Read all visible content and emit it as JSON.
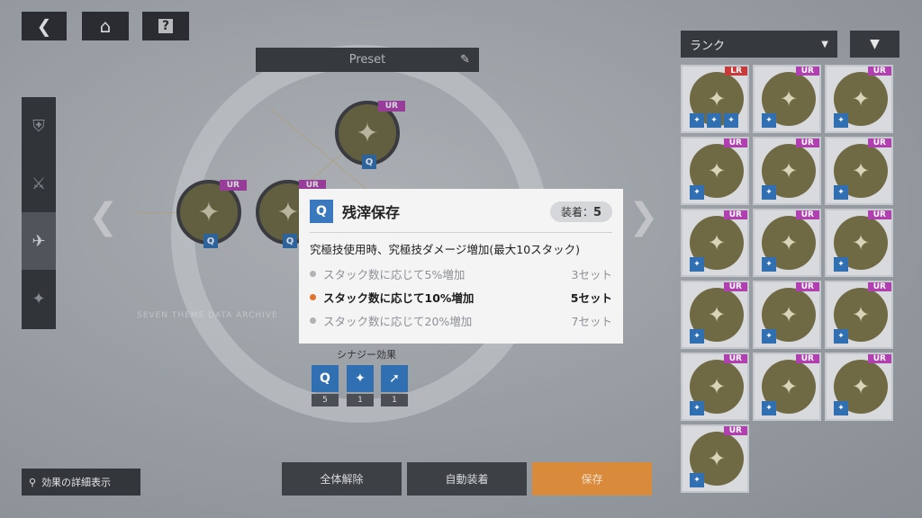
{
  "top": {
    "back_icon": "back-arrow-icon",
    "home_icon": "home-icon",
    "help_icon": "help-icon"
  },
  "preset": {
    "label": "Preset"
  },
  "watermark": "SEVEN THEME DATA ARCHIVE",
  "synergy": {
    "title": "シナジー効果",
    "items": [
      {
        "count": "5"
      },
      {
        "count": "1"
      },
      {
        "count": "1"
      }
    ]
  },
  "detail_button": "効果の詳細表示",
  "buttons": {
    "clear": "全体解除",
    "auto": "自動装着",
    "save": "保存"
  },
  "rank": {
    "label": "ランク"
  },
  "chips": {
    "ur": "UR"
  },
  "popup": {
    "title": "残滓保存",
    "equip_label": "装着：",
    "equip_value": "5",
    "description": "究極技使用時、究極技ダメージ増加(最大10スタック)",
    "tiers": [
      {
        "text": "スタック数に応じて5%増加",
        "sets": "3セット",
        "active": false
      },
      {
        "text": "スタック数に応じて10%増加",
        "sets": "5セット",
        "active": true
      },
      {
        "text": "スタック数に応じて20%増加",
        "sets": "7セット",
        "active": false
      }
    ]
  },
  "inventory": {
    "cards": [
      {
        "rank": "LR"
      },
      {
        "rank": "UR"
      },
      {
        "rank": "UR"
      },
      {
        "rank": "UR"
      },
      {
        "rank": "UR"
      },
      {
        "rank": "UR"
      },
      {
        "rank": "UR"
      },
      {
        "rank": "UR"
      },
      {
        "rank": "UR"
      },
      {
        "rank": "UR"
      },
      {
        "rank": "UR"
      },
      {
        "rank": "UR"
      },
      {
        "rank": "UR"
      },
      {
        "rank": "UR"
      },
      {
        "rank": "UR"
      },
      {
        "rank": "UR"
      }
    ]
  }
}
